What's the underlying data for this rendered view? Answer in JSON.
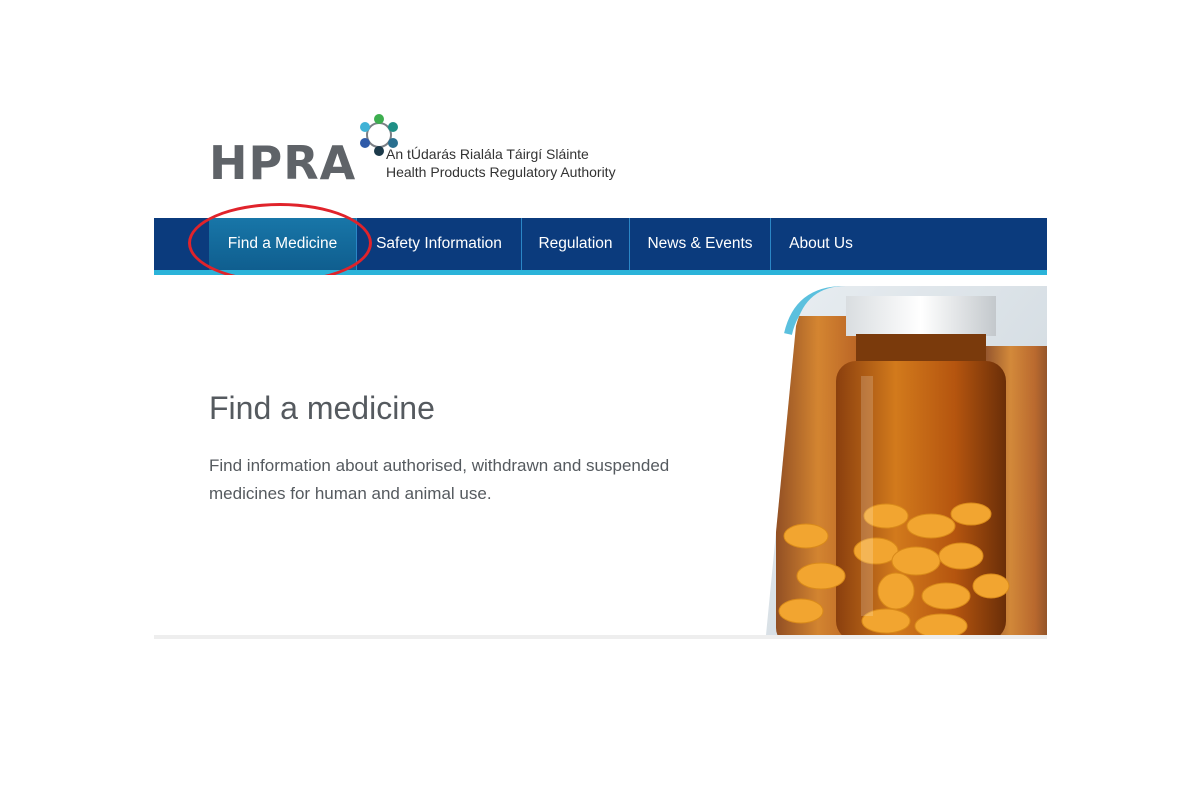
{
  "header": {
    "logo_text": "HPRA",
    "tagline_irish": "An tÚdarás Rialála Táirgí Sláinte",
    "tagline_english": "Health Products Regulatory Authority"
  },
  "nav": {
    "items": [
      {
        "label": "Find a Medicine",
        "active": true
      },
      {
        "label": "Safety Information",
        "active": false
      },
      {
        "label": "Regulation",
        "active": false
      },
      {
        "label": "News & Events",
        "active": false
      },
      {
        "label": "About Us",
        "active": false
      }
    ]
  },
  "hero": {
    "title": "Find a medicine",
    "description": "Find information about authorised, withdrawn and suspended medicines for human and animal use.",
    "image_icon": "medicine-bottles-photo"
  },
  "colors": {
    "nav_background": "#0b3b7d",
    "nav_accent": "#2bb3d9",
    "highlight": "#e0232b",
    "text_grey": "#555a5f"
  }
}
